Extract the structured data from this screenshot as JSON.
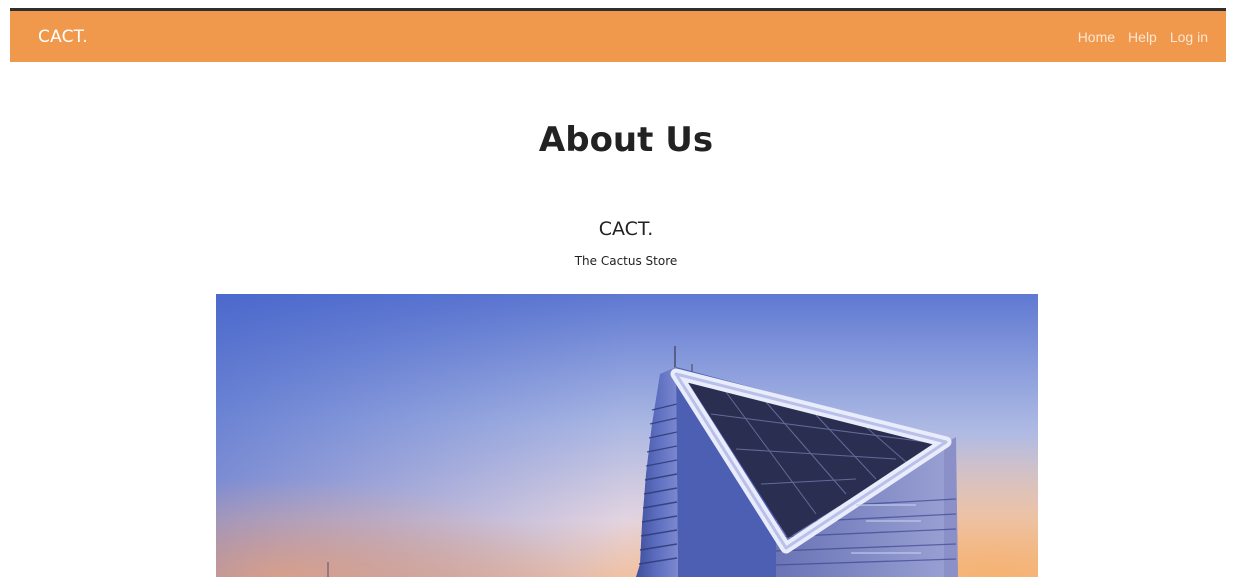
{
  "navbar": {
    "brand": "CACT.",
    "links": [
      {
        "label": "Home"
      },
      {
        "label": "Help"
      },
      {
        "label": "Log in"
      }
    ],
    "background_color": "#f0984b"
  },
  "main": {
    "title": "About Us",
    "company_name": "CACT.",
    "tagline": "The Cactus Store",
    "image": {
      "subject": "modern glass skyscraper with triangular illuminated crown at dusk"
    }
  }
}
